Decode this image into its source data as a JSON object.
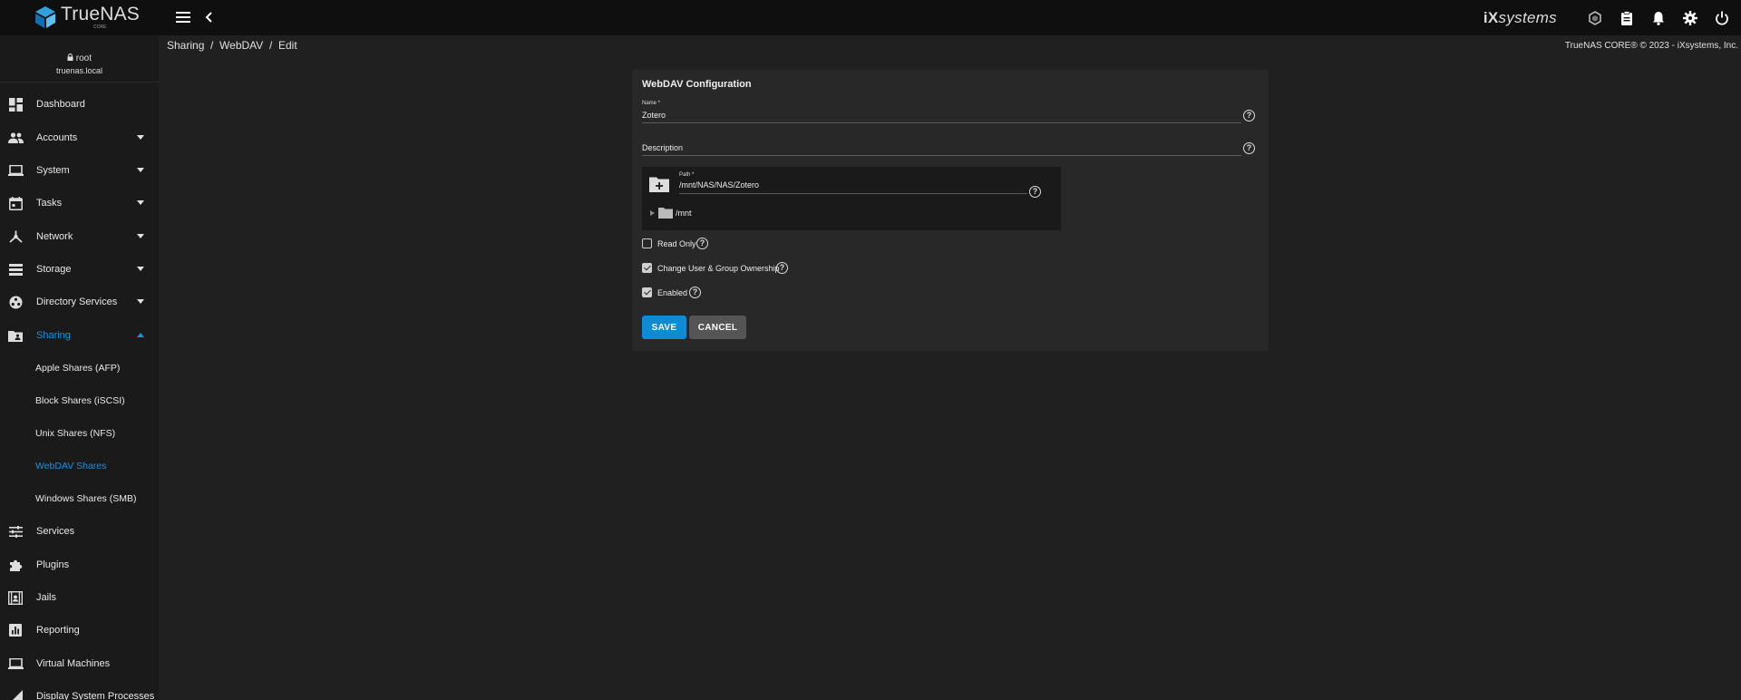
{
  "app": {
    "logo_name": "TrueNAS",
    "logo_sub": "CORE",
    "vendor": "systems",
    "vendor_prefix": "iX"
  },
  "breadcrumb": [
    "Sharing",
    "WebDAV",
    "Edit"
  ],
  "copyright": "TrueNAS CORE® © 2023 - iXsystems, Inc.",
  "user": {
    "name": "root",
    "host": "truenas.local"
  },
  "sidebar": {
    "items": [
      {
        "label": "Dashboard"
      },
      {
        "label": "Accounts"
      },
      {
        "label": "System"
      },
      {
        "label": "Tasks"
      },
      {
        "label": "Network"
      },
      {
        "label": "Storage"
      },
      {
        "label": "Directory Services"
      },
      {
        "label": "Sharing"
      },
      {
        "label": "Services"
      },
      {
        "label": "Plugins"
      },
      {
        "label": "Jails"
      },
      {
        "label": "Reporting"
      },
      {
        "label": "Virtual Machines"
      },
      {
        "label": "Display System Processes"
      }
    ],
    "sharing_sub": [
      {
        "label": "Apple Shares (AFP)"
      },
      {
        "label": "Block Shares (iSCSI)"
      },
      {
        "label": "Unix Shares (NFS)"
      },
      {
        "label": "WebDAV Shares"
      },
      {
        "label": "Windows Shares (SMB)"
      }
    ]
  },
  "form": {
    "title": "WebDAV Configuration",
    "name_label": "Name *",
    "name_value": "Zotero",
    "description_label": "Description",
    "path_label": "Path *",
    "path_value": "/mnt/NAS/NAS/Zotero",
    "tree_root": "/mnt",
    "read_only_label": "Read Only",
    "read_only": false,
    "ownership_label": "Change User & Group Ownership",
    "ownership": true,
    "enabled_label": "Enabled",
    "enabled": true,
    "save_label": "SAVE",
    "cancel_label": "CANCEL"
  },
  "colors": {
    "accent": "#0f8bd3",
    "active_nav": "#1e90d6",
    "background": "#202020",
    "sidebar": "#1a1a1a",
    "card": "#282828"
  }
}
